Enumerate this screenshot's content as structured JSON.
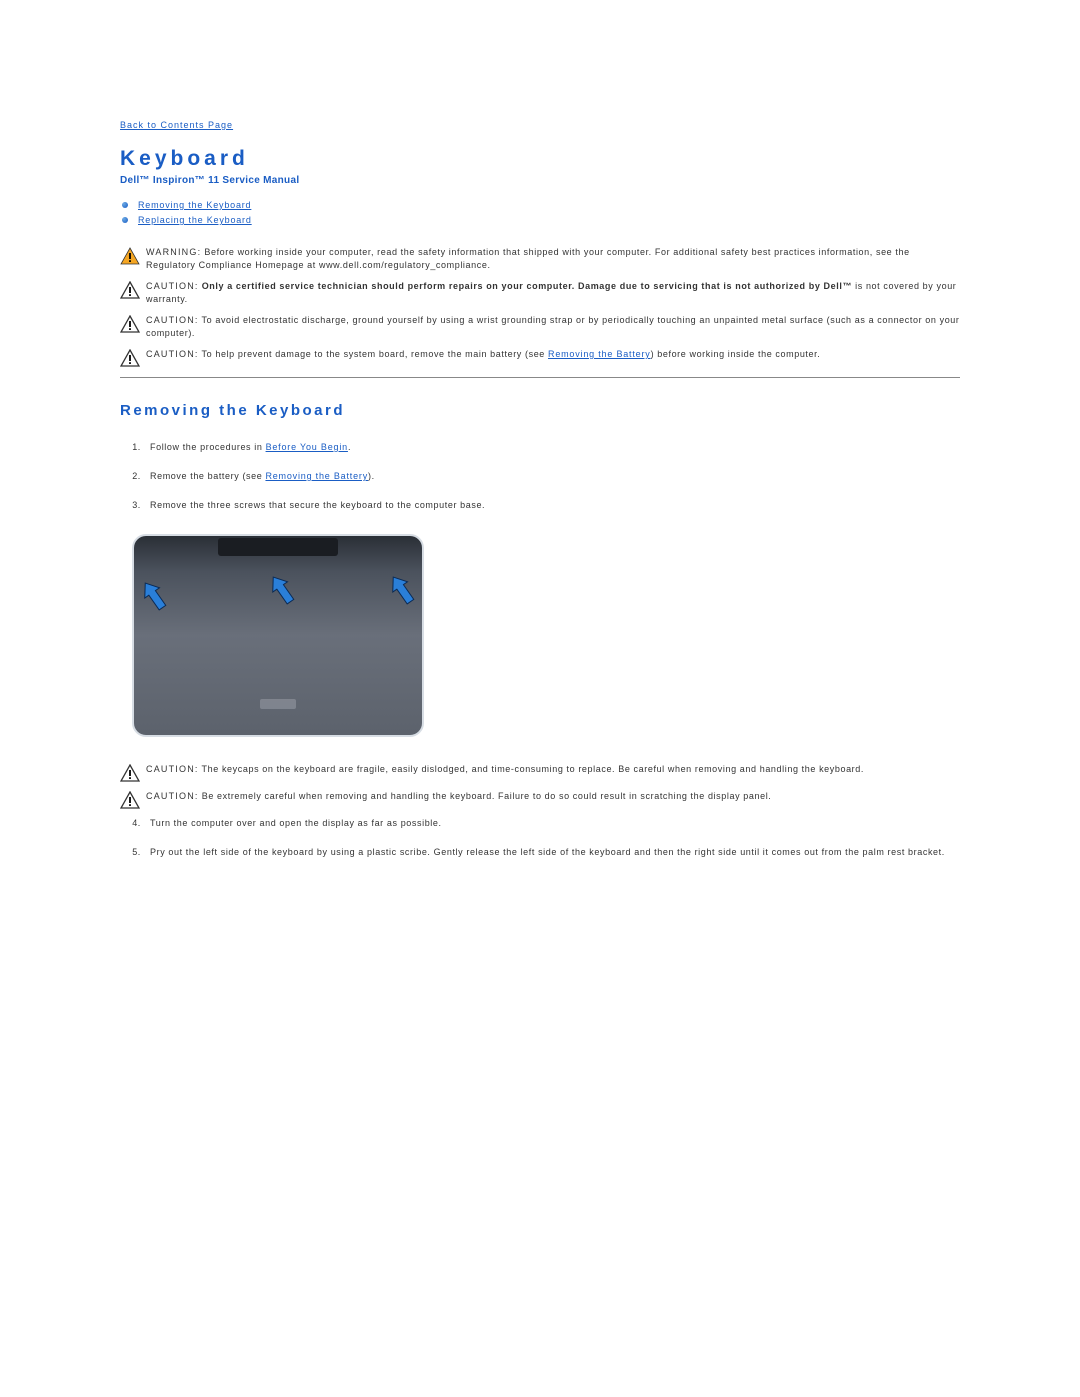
{
  "back_link": "Back to Contents Page",
  "page_title": "Keyboard",
  "manual_name": "Dell™ Inspiron™ 11 Service Manual",
  "toc": {
    "removing": "Removing the Keyboard",
    "replacing": "Replacing the Keyboard"
  },
  "callouts": {
    "warning": {
      "lead": "WARNING:",
      "text": " Before working inside your computer, read the safety information that shipped with your computer. For additional safety best practices information, see the Regulatory Compliance Homepage at www.dell.com/regulatory_compliance."
    },
    "caution_auth": {
      "lead": "CAUTION:",
      "bold": " Only a certified service technician should perform repairs on your computer. Damage due to servicing that is not authorized by Dell™",
      "rest": " is not covered by your warranty."
    },
    "caution_esd": {
      "lead": "CAUTION:",
      "text": " To avoid electrostatic discharge, ground yourself by using a wrist grounding strap or by periodically touching an unpainted metal surface (such as a connector on your computer)."
    },
    "caution_battery": {
      "lead": "CAUTION:",
      "pre": " To help prevent damage to the system board, remove the main battery (see ",
      "link": "Removing the Battery",
      "post": ") before working inside the computer."
    },
    "caution_keycaps": {
      "lead": "CAUTION:",
      "text": " The keycaps on the keyboard are fragile, easily dislodged, and time-consuming to replace. Be careful when removing and handling the keyboard."
    },
    "caution_scratch": {
      "lead": "CAUTION:",
      "text": " Be extremely careful when removing and handling the keyboard. Failure to do so could result in scratching the display panel."
    }
  },
  "section_title": "Removing the Keyboard",
  "steps": {
    "s1_pre": "Follow the procedures in ",
    "s1_link": "Before You Begin",
    "s1_post": ".",
    "s2_pre": "Remove the battery (see ",
    "s2_link": "Removing the Battery",
    "s2_post": ").",
    "s3": "Remove the three screws that secure the keyboard to the computer base.",
    "s4": "Turn the computer over and open the display as far as possible.",
    "s5": "Pry out the left side of the keyboard by using a plastic scribe. Gently release the left side of the keyboard and then the right side until it comes out from the palm rest bracket."
  }
}
